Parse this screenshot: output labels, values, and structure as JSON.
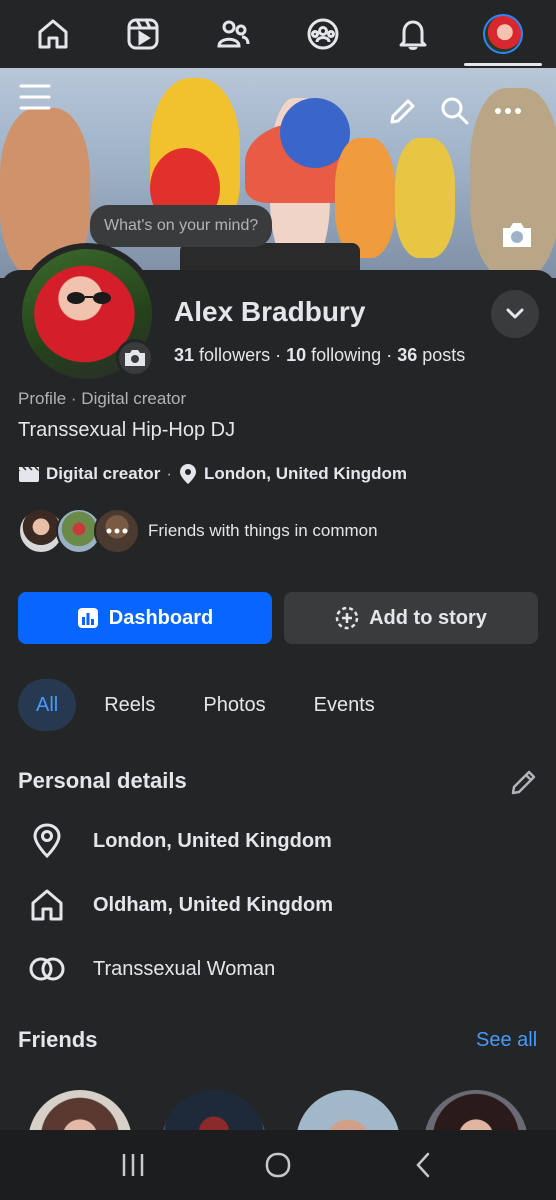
{
  "nav": {
    "items": [
      {
        "name": "home"
      },
      {
        "name": "reels"
      },
      {
        "name": "friends"
      },
      {
        "name": "groups"
      },
      {
        "name": "notifications"
      },
      {
        "name": "profile",
        "active": true
      }
    ]
  },
  "cover": {
    "mind_prompt": "What's on your mind?"
  },
  "profile": {
    "name": "Alex Bradbury",
    "followers_count": "31",
    "followers_label": "followers",
    "following_count": "10",
    "following_label": "following",
    "posts_count": "36",
    "posts_label": "posts",
    "subline": "Profile · Digital creator",
    "bio": "Transsexual Hip-Hop DJ",
    "category": "Digital creator",
    "location": "London, United Kingdom",
    "mutual_text": "Friends with things in common"
  },
  "buttons": {
    "dashboard": "Dashboard",
    "add_story": "Add to story"
  },
  "tabs": [
    "All",
    "Reels",
    "Photos",
    "Events"
  ],
  "personal_details": {
    "title": "Personal details",
    "items": [
      {
        "icon": "location-pin-icon",
        "text": "London, United Kingdom"
      },
      {
        "icon": "home-icon",
        "text": "Oldham, United Kingdom"
      },
      {
        "icon": "rings-icon",
        "text": "Transsexual Woman"
      }
    ]
  },
  "friends": {
    "title": "Friends",
    "see_all": "See all"
  },
  "colors": {
    "background": "#242526",
    "accent": "#0866ff",
    "link": "#4599ff",
    "secondary_button": "#3a3b3c"
  }
}
